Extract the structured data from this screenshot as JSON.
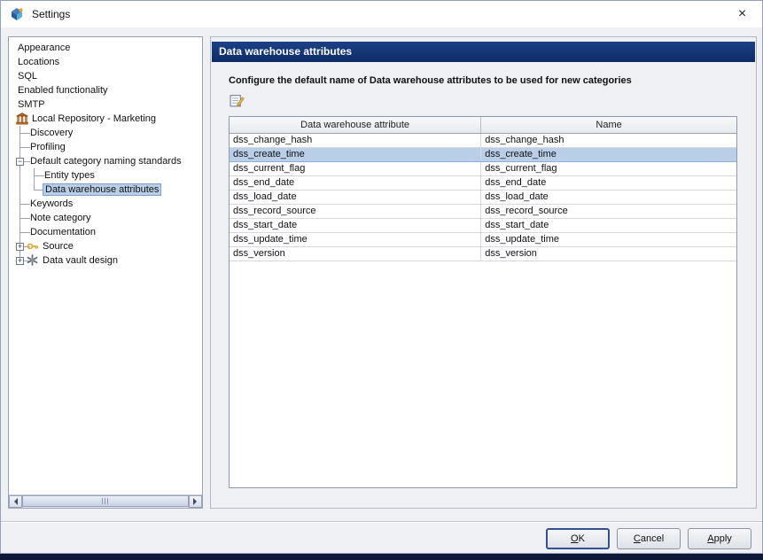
{
  "window": {
    "title": "Settings",
    "close_icon": "×"
  },
  "tree": {
    "items": [
      {
        "label": "Appearance",
        "level": 0
      },
      {
        "label": "Locations",
        "level": 0
      },
      {
        "label": "SQL",
        "level": 0
      },
      {
        "label": "Enabled functionality",
        "level": 0
      },
      {
        "label": "SMTP",
        "level": 0
      },
      {
        "label": "Local Repository - Marketing",
        "level": 0,
        "icon": "repository"
      },
      {
        "label": "Discovery",
        "level": 1,
        "tick": true
      },
      {
        "label": "Profiling",
        "level": 1,
        "tick": true
      },
      {
        "label": "Default category naming standards",
        "level": 1,
        "tick": true,
        "expander": "minus"
      },
      {
        "label": "Entity types",
        "level": 2,
        "tick": true
      },
      {
        "label": "Data warehouse attributes",
        "level": 2,
        "tick": true,
        "selected": true
      },
      {
        "label": "Keywords",
        "level": 1,
        "tick": true
      },
      {
        "label": "Note category",
        "level": 1,
        "tick": true
      },
      {
        "label": "Documentation",
        "level": 1,
        "tick": true
      },
      {
        "label": "Source",
        "level": 1,
        "tick": true,
        "expander": "plus",
        "icon": "key"
      },
      {
        "label": "Data vault design",
        "level": 1,
        "tick": true,
        "expander": "plus",
        "icon": "vault"
      }
    ]
  },
  "panel": {
    "title": "Data warehouse attributes",
    "description": "Configure the default name of Data warehouse attributes to be used for new categories",
    "toolbar": {
      "edit_icon": "edit-table-icon"
    },
    "table": {
      "columns": [
        "Data warehouse attribute",
        "Name"
      ],
      "rows": [
        [
          "dss_change_hash",
          "dss_change_hash"
        ],
        [
          "dss_create_time",
          "dss_create_time"
        ],
        [
          "dss_current_flag",
          "dss_current_flag"
        ],
        [
          "dss_end_date",
          "dss_end_date"
        ],
        [
          "dss_load_date",
          "dss_load_date"
        ],
        [
          "dss_record_source",
          "dss_record_source"
        ],
        [
          "dss_start_date",
          "dss_start_date"
        ],
        [
          "dss_update_time",
          "dss_update_time"
        ],
        [
          "dss_version",
          "dss_version"
        ]
      ],
      "selected_row": 1
    }
  },
  "buttons": [
    {
      "id": "ok",
      "label": "OK",
      "mnemonic": 0,
      "default": true
    },
    {
      "id": "cancel",
      "label": "Cancel",
      "mnemonic": 0
    },
    {
      "id": "apply",
      "label": "Apply",
      "mnemonic": 0
    }
  ],
  "colors": {
    "header_bg": "#1c4187",
    "header_bg_dark": "#0d2b66",
    "selection": "#b9cfe8",
    "accent": "#35508f"
  }
}
